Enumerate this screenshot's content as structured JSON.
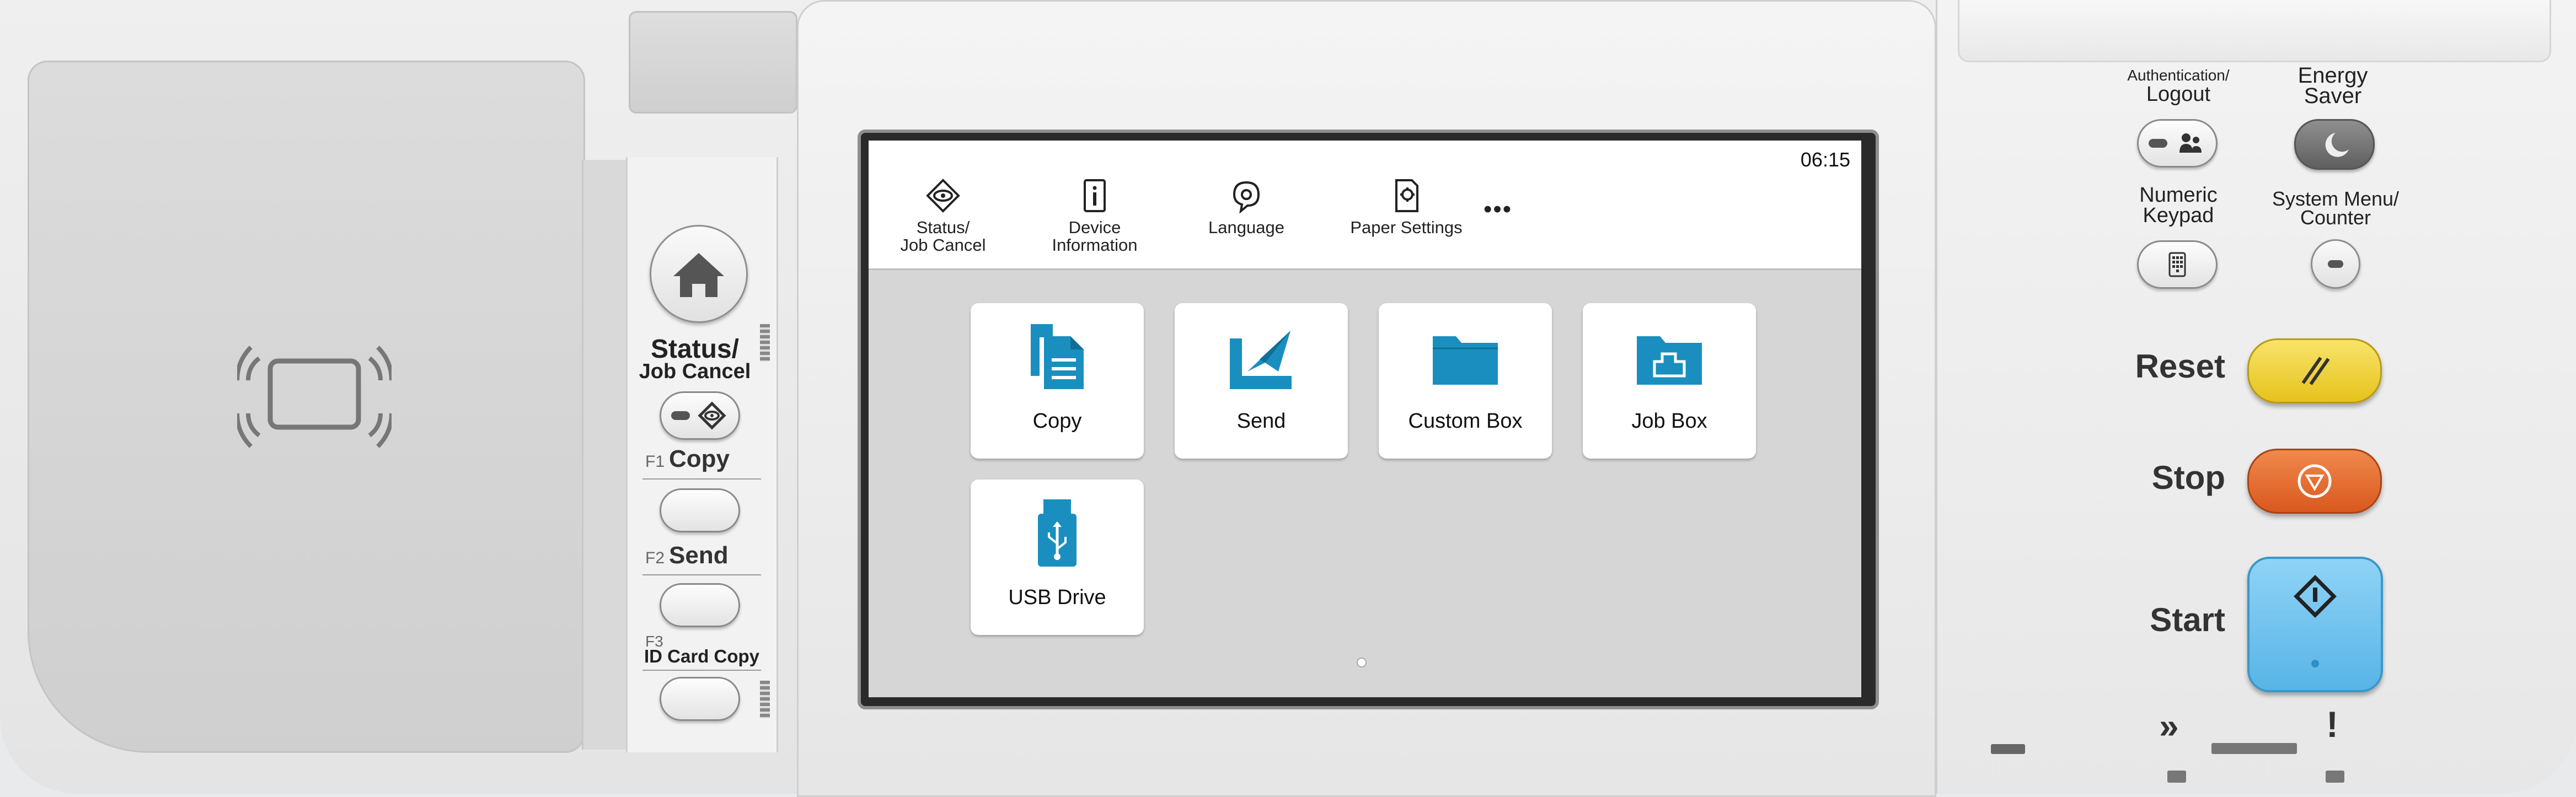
{
  "screen": {
    "clock": "06:15",
    "top_items": [
      {
        "label_line1": "Status/",
        "label_line2": "Job Cancel",
        "icon": "status-eye-icon"
      },
      {
        "label_line1": "Device",
        "label_line2": "Information",
        "icon": "device-info-icon"
      },
      {
        "label_line1": "Language",
        "label_line2": "",
        "icon": "language-icon"
      },
      {
        "label_line1": "Paper Settings",
        "label_line2": "",
        "icon": "paper-settings-icon"
      }
    ],
    "more_label": "•••",
    "tiles": [
      {
        "label": "Copy",
        "icon": "copy-icon"
      },
      {
        "label": "Send",
        "icon": "send-icon"
      },
      {
        "label": "Custom Box",
        "icon": "folder-icon"
      },
      {
        "label": "Job Box",
        "icon": "job-box-icon"
      },
      {
        "label": "USB Drive",
        "icon": "usb-drive-icon"
      }
    ],
    "accent_color": "#1a8fbf"
  },
  "left_keys": {
    "status_line1": "Status/",
    "status_line2": "Job Cancel",
    "f1_prefix": "F1",
    "f1_label": "Copy",
    "f2_prefix": "F2",
    "f2_label": "Send",
    "f3_prefix": "F3",
    "f3_label": "ID Card Copy"
  },
  "right_panel": {
    "auth_line1": "Authentication/",
    "auth_line2": "Logout",
    "energy_line1": "Energy",
    "energy_line2": "Saver",
    "numeric_line1": "Numeric",
    "numeric_line2": "Keypad",
    "sysmenu_line1": "System Menu/",
    "sysmenu_line2": "Counter",
    "reset_label": "Reset",
    "stop_label": "Stop",
    "start_label": "Start",
    "reset_color": "#f2d22e",
    "stop_color": "#e06a2f",
    "start_color": "#6cc2ee",
    "processing_indicator": "»",
    "attention_indicator": "!"
  }
}
